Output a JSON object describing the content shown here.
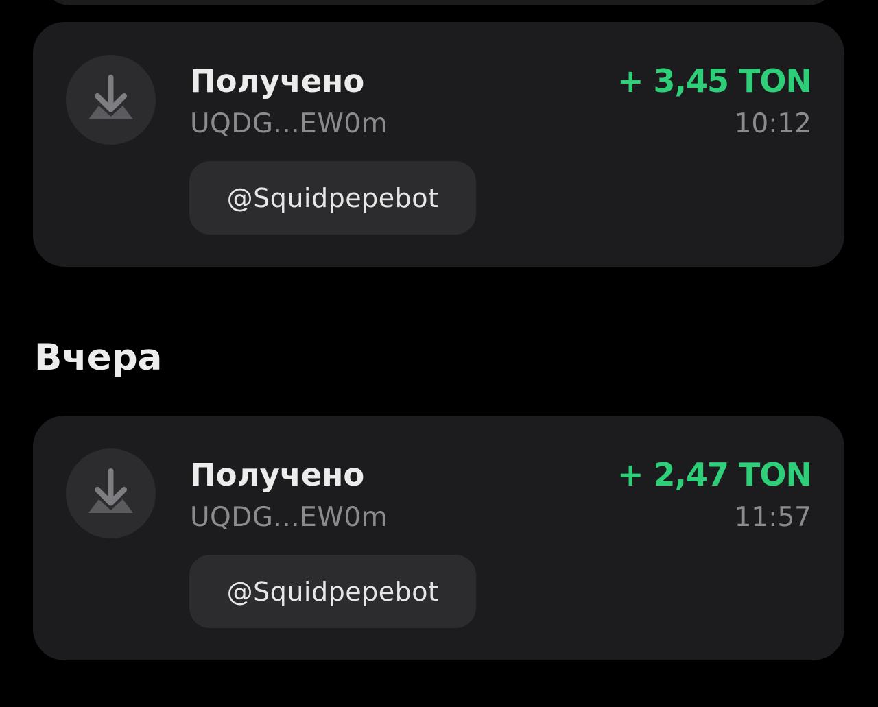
{
  "colors": {
    "background": "#000000",
    "card": "#1c1c1e",
    "icon_bg": "#2c2c2e",
    "amount_positive": "#2fcf7a",
    "secondary_text": "#8b8b8f"
  },
  "sections": [
    {
      "header": "",
      "transactions": [
        {
          "icon": "arrow-down-receive-icon",
          "title": "Получено",
          "address": "UQDG...EW0m",
          "amount": "+ 3,45 TON",
          "time": "10:12",
          "comment": "@Squidpepebot"
        }
      ]
    },
    {
      "header": "Вчера",
      "transactions": [
        {
          "icon": "arrow-down-receive-icon",
          "title": "Получено",
          "address": "UQDG...EW0m",
          "amount": "+ 2,47 TON",
          "time": "11:57",
          "comment": "@Squidpepebot"
        }
      ]
    }
  ]
}
